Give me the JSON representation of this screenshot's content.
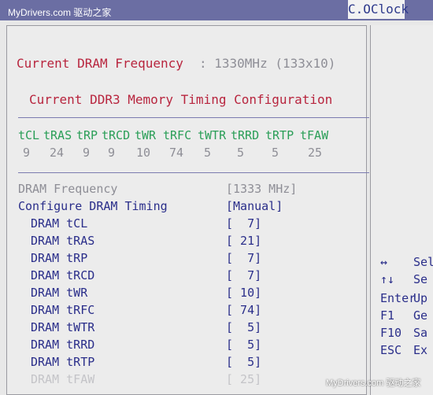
{
  "watermark": "MyDrivers.com 驱动之家",
  "tab": "C.OClock",
  "current_freq": {
    "label": "Current DRAM Frequency",
    "value": ": 1330MHz (133x10)"
  },
  "config_title": "Current DDR3 Memory Timing Configuration",
  "timings": {
    "headers": [
      "tCL",
      "tRAS",
      "tRP",
      "tRCD",
      "tWR",
      "tRFC",
      "tWTR",
      "tRRD",
      "tRTP",
      "tFAW"
    ],
    "values": [
      "9",
      "24",
      "9",
      "9",
      "10",
      "74",
      "5",
      "5",
      "5",
      "25"
    ]
  },
  "settings": [
    {
      "label": "DRAM Frequency",
      "value": "[1333 MHz]"
    },
    {
      "label": "Configure DRAM Timing",
      "value": "[Manual]"
    },
    {
      "label": "DRAM tCL",
      "value": "[  7]"
    },
    {
      "label": "DRAM tRAS",
      "value": "[ 21]"
    },
    {
      "label": "DRAM tRP",
      "value": "[  7]"
    },
    {
      "label": "DRAM tRCD",
      "value": "[  7]"
    },
    {
      "label": "DRAM tWR",
      "value": "[ 10]"
    },
    {
      "label": "DRAM tRFC",
      "value": "[ 74]"
    },
    {
      "label": "DRAM tWTR",
      "value": "[  5]"
    },
    {
      "label": "DRAM tRRD",
      "value": "[  5]"
    },
    {
      "label": "DRAM tRTP",
      "value": "[  5]"
    },
    {
      "label": "DRAM tFAW",
      "value": "[ 25]"
    }
  ],
  "help": [
    {
      "key": "↔",
      "text": "Sel"
    },
    {
      "key": "↑↓",
      "text": "Se"
    },
    {
      "key": "Enter",
      "text": "Up"
    },
    {
      "key": "F1",
      "text": "Ge"
    },
    {
      "key": "F10",
      "text": "Sa"
    },
    {
      "key": "ESC",
      "text": "Ex"
    }
  ],
  "colors": {
    "accent_red": "#b8253e",
    "timing_green": "#2a9e57",
    "label_navy": "#2a2e8a"
  }
}
